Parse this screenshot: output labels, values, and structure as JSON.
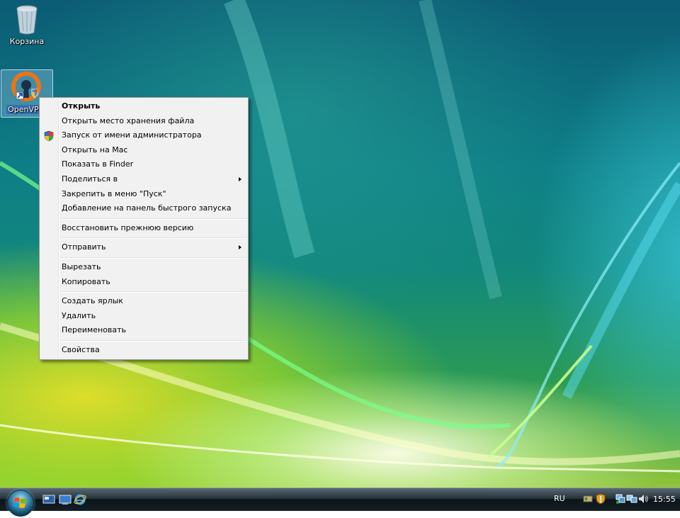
{
  "desktop": {
    "icons": [
      {
        "label": "Корзина"
      },
      {
        "label": "OpenVPN"
      }
    ]
  },
  "context_menu": {
    "items": [
      {
        "label": "Открыть"
      },
      {
        "label": "Открыть место хранения файла"
      },
      {
        "label": "Запуск от имени администратора",
        "icon": "uac-shield-icon"
      },
      {
        "label": "Открыть на Mac"
      },
      {
        "label": "Показать в Finder"
      },
      {
        "label": "Поделиться в",
        "submenu": true
      },
      {
        "label": "Закрепить в меню \"Пуск\""
      },
      {
        "label": "Добавление на панель быстрого запуска"
      },
      {
        "label": "Восстановить прежнюю версию"
      },
      {
        "label": "Отправить",
        "submenu": true
      },
      {
        "label": "Вырезать"
      },
      {
        "label": "Копировать"
      },
      {
        "label": "Создать ярлык"
      },
      {
        "label": "Удалить"
      },
      {
        "label": "Переименовать"
      },
      {
        "label": "Свойства"
      }
    ]
  },
  "taskbar": {
    "quick_launch": [
      "show-desktop-icon",
      "switch-windows-icon",
      "internet-explorer-icon"
    ],
    "language": "RU",
    "tray_icons": [
      "safely-remove-icon",
      "security-alert-icon",
      "network-icon",
      "network-activity-icon",
      "volume-icon"
    ],
    "clock": "15:55"
  }
}
